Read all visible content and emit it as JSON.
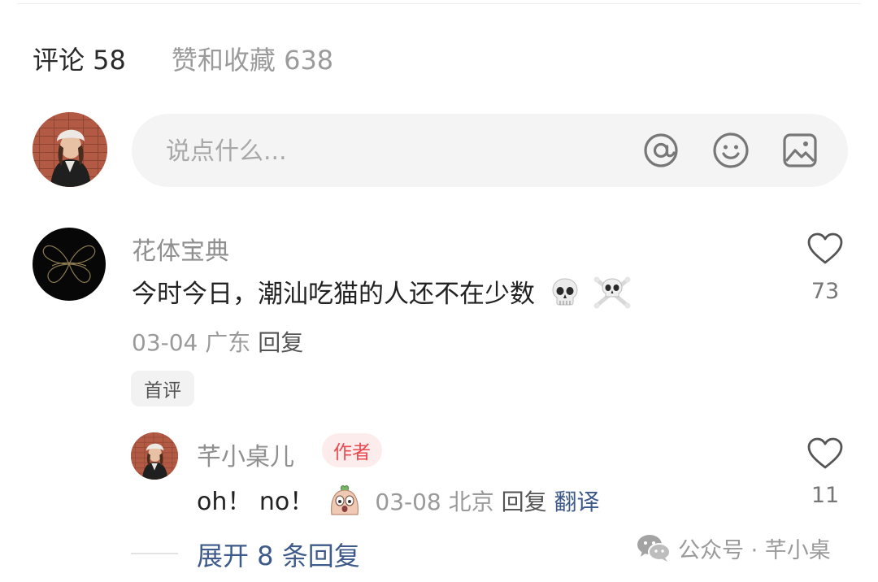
{
  "tabs": {
    "comments": "评论 58",
    "likes_favorites": "赞和收藏 638"
  },
  "composer": {
    "placeholder": "说点什么..."
  },
  "comment": {
    "username": "花体宝典",
    "text": "今时今日，潮汕吃猫的人还不在少数",
    "date": "03-04",
    "location": "广东",
    "reply_label": "回复",
    "first_badge": "首评",
    "likes": "73",
    "emojis": [
      "skull",
      "skull-and-crossbones"
    ]
  },
  "reply": {
    "username": "芊小桌儿",
    "author_badge": "作者",
    "text": "oh！ no！",
    "date": "03-08",
    "location": "北京",
    "reply_label": "回复",
    "translate_label": "翻译",
    "likes": "11"
  },
  "expand_replies": "展开 8 条回复",
  "watermark": "公众号 · 芊小桌",
  "colors": {
    "link_blue": "#3d5a8a",
    "author_red": "#e84a50",
    "muted_gray": "#9a9a9a",
    "input_bg": "#f4f4f4"
  }
}
